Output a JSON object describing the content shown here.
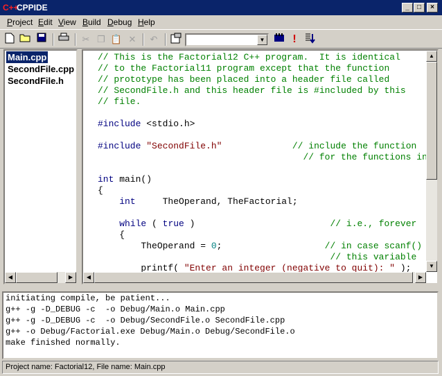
{
  "window": {
    "title": "CPPIDE",
    "icon_text": "C++"
  },
  "menu": [
    {
      "key": "P",
      "rest": "roject"
    },
    {
      "key": "E",
      "rest": "dit"
    },
    {
      "key": "V",
      "rest": "iew"
    },
    {
      "key": "B",
      "rest": "uild"
    },
    {
      "key": "D",
      "rest": "ebug"
    },
    {
      "key": "H",
      "rest": "elp"
    }
  ],
  "toolbar": {
    "config_value": ""
  },
  "files": [
    "Main.cpp",
    "SecondFile.cpp",
    "SecondFile.h"
  ],
  "editor": {
    "lines": [
      [
        {
          "t": "// This is the Factorial12 C++ program.  It is identical",
          "c": "c"
        }
      ],
      [
        {
          "t": "// to the Factorial11 program except that the function",
          "c": "c"
        }
      ],
      [
        {
          "t": "// prototype has been placed into a header file called",
          "c": "c"
        }
      ],
      [
        {
          "t": "// SecondFile.h and this header file is #included by this",
          "c": "c"
        }
      ],
      [
        {
          "t": "// file.",
          "c": "c"
        }
      ],
      [],
      [
        {
          "t": "#include",
          "c": "k"
        },
        {
          "t": " <stdio.h>",
          "c": ""
        }
      ],
      [],
      [
        {
          "t": "#include",
          "c": "k"
        },
        {
          "t": " ",
          "c": ""
        },
        {
          "t": "\"SecondFile.h\"",
          "c": "s"
        },
        {
          "t": "             ",
          "c": ""
        },
        {
          "t": "// include the function",
          "c": "c"
        }
      ],
      [
        {
          "t": "                                      ",
          "c": ""
        },
        {
          "t": "// for the functions in",
          "c": "c"
        }
      ],
      [],
      [
        {
          "t": "int",
          "c": "k"
        },
        {
          "t": " main()",
          "c": ""
        }
      ],
      [
        {
          "t": "{",
          "c": ""
        }
      ],
      [
        {
          "t": "    ",
          "c": ""
        },
        {
          "t": "int",
          "c": "k"
        },
        {
          "t": "     TheOperand, TheFactorial;",
          "c": ""
        }
      ],
      [],
      [
        {
          "t": "    ",
          "c": ""
        },
        {
          "t": "while",
          "c": "k"
        },
        {
          "t": " ( ",
          "c": ""
        },
        {
          "t": "true",
          "c": "k"
        },
        {
          "t": " )                         ",
          "c": ""
        },
        {
          "t": "// i.e., forever",
          "c": "c"
        }
      ],
      [
        {
          "t": "    {",
          "c": ""
        }
      ],
      [
        {
          "t": "        TheOperand = ",
          "c": ""
        },
        {
          "t": "0",
          "c": "n"
        },
        {
          "t": ";                   ",
          "c": ""
        },
        {
          "t": "// in case scanf()",
          "c": "c"
        }
      ],
      [
        {
          "t": "                                           ",
          "c": ""
        },
        {
          "t": "// this variable",
          "c": "c"
        }
      ],
      [
        {
          "t": "        printf( ",
          "c": ""
        },
        {
          "t": "\"Enter an integer (negative to quit): \"",
          "c": "s"
        },
        {
          "t": " );",
          "c": ""
        }
      ]
    ]
  },
  "output": [
    "initiating compile, be patient...",
    "g++ -g -D_DEBUG -c  -o Debug/Main.o Main.cpp",
    "g++ -g -D_DEBUG -c  -o Debug/SecondFile.o SecondFile.cpp",
    "g++ -o Debug/Factorial.exe Debug/Main.o Debug/SecondFile.o",
    "make finished normally."
  ],
  "status": "Project name: Factorial12, File name: Main.cpp"
}
